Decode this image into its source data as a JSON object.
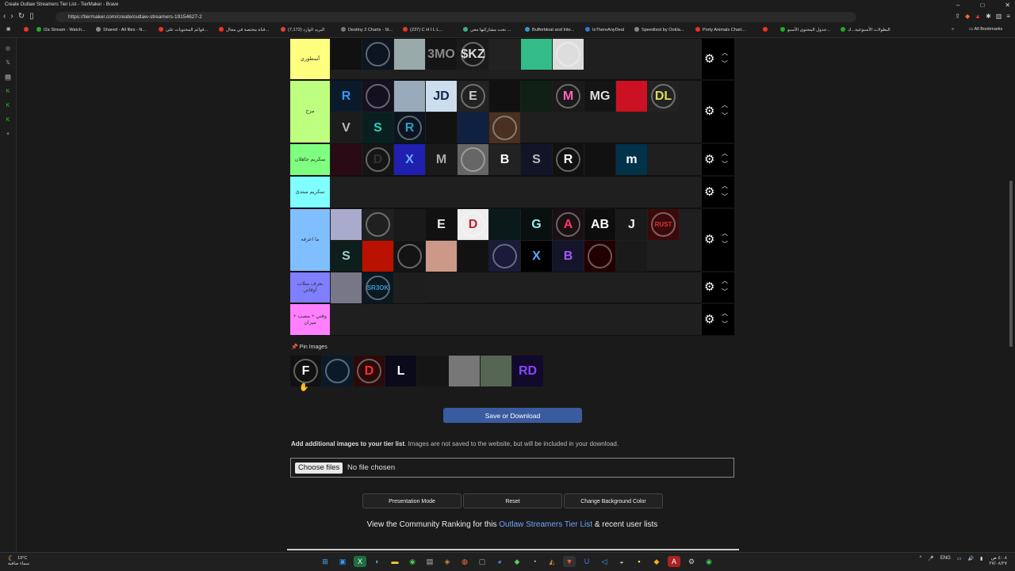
{
  "browser": {
    "window_title": "Create Outlaw Streamers Tier List - TierMaker - Brave",
    "url": "https://tiermaker.com/create/outlaw-streamers-19154627-2",
    "all_bookmarks": "All Bookmarks",
    "bookmarks": [
      {
        "label": "I2a Stream - Watch...",
        "color": "#e32"
      },
      {
        "label": "Shared - All files - N...",
        "color": "#888"
      },
      {
        "label": "قوائم المحتويات على...",
        "color": "#e32"
      },
      {
        "label": "قناة مختصة في مجال...",
        "color": "#e32"
      },
      {
        "label": "البريد الوارد (7,172)",
        "color": "#d44"
      },
      {
        "label": "Destiny 2 Charts - St...",
        "color": "#777"
      },
      {
        "label": "(237) C H I L L...",
        "color": "#e32"
      },
      {
        "label": "تحت مشاركتها معي ...",
        "color": "#4a8"
      },
      {
        "label": "Bufferbloat and Inte...",
        "color": "#39c"
      },
      {
        "label": "IsThereAnyDeal",
        "color": "#37c"
      },
      {
        "label": "Speedtest by Ookla...",
        "color": "#888"
      },
      {
        "label": "Porty Animals Chart...",
        "color": "#e32"
      },
      {
        "label": "جدول المحتوى الأسبو...",
        "color": "#2a2"
      },
      {
        "label": "البطولات الأسبوعية...ك",
        "color": "#2a2"
      }
    ]
  },
  "tiers": [
    {
      "label": "أسطوري",
      "color": "#ffff7f"
    },
    {
      "label": "مزح",
      "color": "#bfff7f"
    },
    {
      "label": "سكريم جاهلان",
      "color": "#7fff7f"
    },
    {
      "label": "سكريم مبتدئ",
      "color": "#7fffff"
    },
    {
      "label": "ما اعرفه",
      "color": "#7fbfff"
    },
    {
      "label": "بعرف متلات اوقاتي",
      "color": "#7f7fff"
    },
    {
      "label": "وقتي + مصب + ميزان",
      "color": "#ff7fff"
    }
  ],
  "tier_images": [
    [
      {
        "t": "",
        "bg": "#111",
        "c": "#c22"
      },
      {
        "t": "",
        "bg": "#0d1520",
        "c": "#7af"
      },
      {
        "t": "",
        "bg": "#9aa",
        "c": "#333"
      },
      {
        "t": "3MO",
        "bg": "#151515",
        "c": "#888"
      },
      {
        "t": "$KZ",
        "bg": "#1a1a1a",
        "c": "#ddd"
      },
      {
        "t": "",
        "bg": "#222",
        "c": "#eee"
      },
      {
        "t": "",
        "bg": "#3b8",
        "c": "#b73"
      },
      {
        "t": "",
        "bg": "#ddd",
        "c": "#a86"
      }
    ],
    [
      {
        "t": "R",
        "bg": "#0b1a2a",
        "c": "#39f"
      },
      {
        "t": "",
        "bg": "#151020",
        "c": "#a3f"
      },
      {
        "t": "",
        "bg": "#9ab",
        "c": "#556"
      },
      {
        "t": "JD",
        "bg": "#cde",
        "c": "#0c2850"
      },
      {
        "t": "E",
        "bg": "#222",
        "c": "#ccc"
      },
      {
        "t": "",
        "bg": "#111",
        "c": "#eee"
      },
      {
        "t": "",
        "bg": "#102015",
        "c": "#3d6"
      },
      {
        "t": "M",
        "bg": "#1a1a1a",
        "c": "#f6b"
      },
      {
        "t": "MG",
        "bg": "#141414",
        "c": "#ddd"
      },
      {
        "t": "",
        "bg": "#c12",
        "c": "#fff"
      },
      {
        "t": "DL",
        "bg": "#222",
        "c": "#dd5"
      },
      {
        "t": "V",
        "bg": "#1c1c1c",
        "c": "#bbb"
      },
      {
        "t": "S",
        "bg": "#082020",
        "c": "#3cb"
      },
      {
        "t": "R",
        "bg": "#0a1520",
        "c": "#39c"
      },
      {
        "t": "",
        "bg": "#121212",
        "c": "#ddd"
      },
      {
        "t": "",
        "bg": "#102040",
        "c": "#a33"
      },
      {
        "t": "",
        "bg": "#4a3020",
        "c": "#fff"
      }
    ],
    [
      {
        "t": "",
        "bg": "#2a0a14",
        "c": "#f39"
      },
      {
        "t": "D",
        "bg": "#151515",
        "c": "#333"
      },
      {
        "t": "X",
        "bg": "#2020b0",
        "c": "#6af"
      },
      {
        "t": "M",
        "bg": "#1a1a1a",
        "c": "#aaa"
      },
      {
        "t": "",
        "bg": "#666",
        "c": "#ddd"
      },
      {
        "t": "B",
        "bg": "#222",
        "c": "#fff"
      },
      {
        "t": "S",
        "bg": "#141428",
        "c": "#bbb"
      },
      {
        "t": "R",
        "bg": "#111",
        "c": "#fff"
      },
      {
        "t": "",
        "bg": "#111",
        "c": "#e52"
      },
      {
        "t": "m",
        "bg": "#00324a",
        "c": "#fff"
      }
    ],
    [],
    [
      {
        "t": "",
        "bg": "#aac",
        "c": "#fff"
      },
      {
        "t": "",
        "bg": "#202020",
        "c": "#888"
      },
      {
        "t": "",
        "bg": "#1a1a1a",
        "c": "#eee"
      },
      {
        "t": "E",
        "bg": "#111",
        "c": "#eee"
      },
      {
        "t": "D",
        "bg": "#eee",
        "c": "#b22"
      },
      {
        "t": "",
        "bg": "#0a1a1a",
        "c": "#3cc"
      },
      {
        "t": "G",
        "bg": "#081010",
        "c": "#9ee"
      },
      {
        "t": "A",
        "bg": "#1a1014",
        "c": "#f36"
      },
      {
        "t": "AB",
        "bg": "#0d0d0d",
        "c": "#fff"
      },
      {
        "t": "J",
        "bg": "#1a1a1a",
        "c": "#eee"
      },
      {
        "t": "RUST",
        "bg": "#3a0a0a",
        "c": "#d33"
      },
      {
        "t": "S",
        "bg": "#0e1e1c",
        "c": "#9cc"
      },
      {
        "t": "",
        "bg": "#b10",
        "c": "#200"
      },
      {
        "t": "",
        "bg": "#141414",
        "c": "#666"
      },
      {
        "t": "",
        "bg": "#c98",
        "c": "#fff"
      },
      {
        "t": "",
        "bg": "#121212",
        "c": "#eee"
      },
      {
        "t": "",
        "bg": "#1a1a3a",
        "c": "#c32"
      },
      {
        "t": "X",
        "bg": "#000",
        "c": "#5af"
      },
      {
        "t": "B",
        "bg": "#14142a",
        "c": "#a5f"
      },
      {
        "t": "",
        "bg": "#200",
        "c": "#c22"
      },
      {
        "t": "",
        "bg": "#1a1a1a",
        "c": "#ddd"
      }
    ],
    [
      {
        "t": "",
        "bg": "#778",
        "c": "#fff"
      },
      {
        "t": "SR3OK",
        "bg": "#0a1822",
        "c": "#39c"
      },
      {
        "t": "",
        "bg": "#1e1e1e",
        "c": "#444"
      }
    ],
    []
  ],
  "pin": {
    "label": "Pin Images",
    "images": [
      {
        "t": "F",
        "bg": "#111",
        "c": "#fff"
      },
      {
        "t": "",
        "bg": "#0a1a2a",
        "c": "#9cf"
      },
      {
        "t": "D",
        "bg": "#2a0a0a",
        "c": "#f33"
      },
      {
        "t": "L",
        "bg": "#0a0a1a",
        "c": "#fff"
      },
      {
        "t": "",
        "bg": "#151515",
        "c": "#555"
      },
      {
        "t": "",
        "bg": "#777",
        "c": "#eee"
      },
      {
        "t": "",
        "bg": "#565",
        "c": "#aa8"
      },
      {
        "t": "RD",
        "bg": "#110a2a",
        "c": "#84f"
      }
    ]
  },
  "actions": {
    "save": "Save or Download",
    "add_bold": "Add additional images to your tier list",
    "add_rest": ". Images are not saved to the website, but will be included in your download.",
    "choose_files": "Choose files",
    "no_file": "No file chosen",
    "presentation": "Presentation Mode",
    "reset": "Reset",
    "change_bg": "Change Background Color",
    "community_pre": "View the Community Ranking for this ",
    "community_link": "Outlaw Streamers Tier List",
    "community_post": " & recent user lists"
  },
  "taskbar": {
    "temp": "19°C",
    "weather": "سماء صافية",
    "lang": "ENG",
    "time": "٤:٠٨ ص",
    "date": "٢٧/٠٨/٢٧"
  }
}
